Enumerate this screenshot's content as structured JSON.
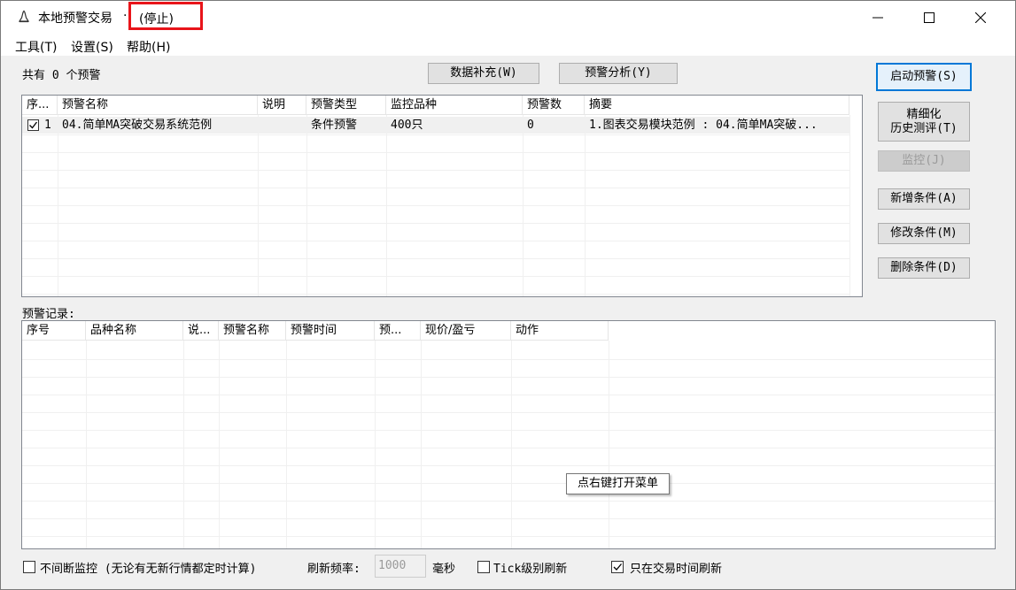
{
  "window": {
    "title": "本地预警交易",
    "separator": "·",
    "status": "(停止)"
  },
  "menu": [
    "工具(T)",
    "设置(S)",
    "帮助(H)"
  ],
  "summary": {
    "count_text": "共有 0 个预警"
  },
  "toolbar": {
    "data_supplement": "数据补充(W)",
    "alert_analysis": "预警分析(Y)"
  },
  "side_buttons": {
    "start": "启动预警(S)",
    "refine": "精细化\n历史测评(T)",
    "monitor": "监控(J)",
    "add": "新增条件(A)",
    "modify": "修改条件(M)",
    "delete": "删除条件(D)"
  },
  "alert_table": {
    "columns": [
      "序...",
      "预警名称",
      "说明",
      "预警类型",
      "监控品种",
      "预警数",
      "摘要"
    ],
    "rows": [
      {
        "checked": true,
        "index": "1",
        "name": "04.简单MA突破交易系统范例",
        "desc": "",
        "type": "条件预警",
        "symbol": "400只",
        "count": "0",
        "summary": "1.图表交易模块范例 : 04.简单MA突破..."
      }
    ]
  },
  "record": {
    "label": "预警记录:",
    "columns": [
      "序号",
      "品种名称",
      "说...",
      "预警名称",
      "预警时间",
      "预...",
      "现价/盈亏",
      "动作"
    ],
    "tooltip": "点右键打开菜单"
  },
  "bottom": {
    "continuous_label": "不间断监控 (无论有无新行情都定时计算)",
    "continuous_checked": false,
    "refresh_label": "刷新频率:",
    "refresh_value": "1000",
    "refresh_unit": "毫秒",
    "tick_label": "Tick级别刷新",
    "tick_checked": false,
    "trading_label": "只在交易时间刷新",
    "trading_checked": true
  },
  "colors": {
    "highlight": "#e8141a",
    "accent": "#0078d7"
  },
  "icons": [
    "bell-icon",
    "minimize-icon",
    "maximize-icon",
    "close-icon",
    "checkbox-checked-icon",
    "checkbox-empty-icon"
  ]
}
